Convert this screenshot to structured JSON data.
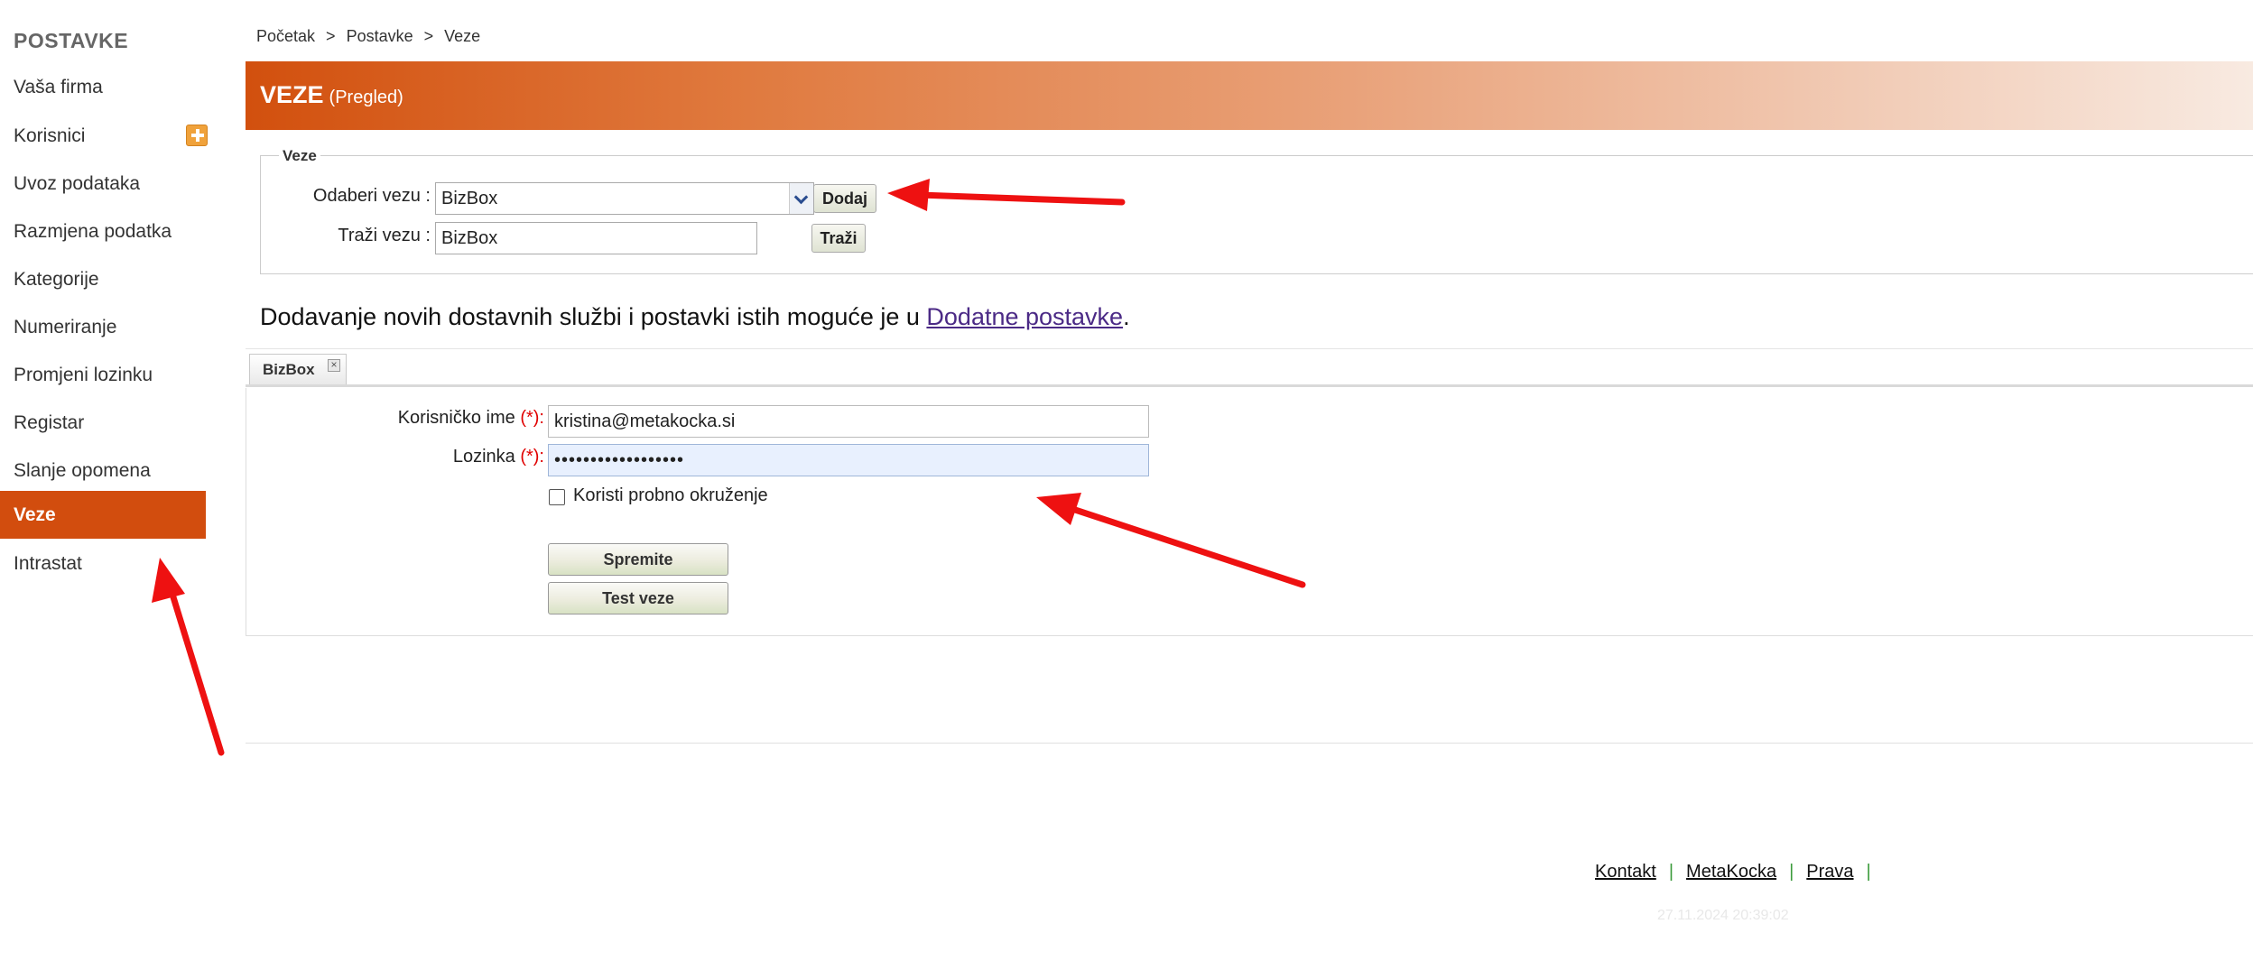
{
  "sidebar": {
    "title": "POSTAVKE",
    "items": [
      {
        "label": "Vaša firma"
      },
      {
        "label": "Korisnici"
      },
      {
        "label": "Uvoz podataka"
      },
      {
        "label": "Razmjena podatka"
      },
      {
        "label": "Kategorije"
      },
      {
        "label": "Numeriranje"
      },
      {
        "label": "Promjeni lozinku"
      },
      {
        "label": "Registar"
      },
      {
        "label": "Slanje opomena"
      },
      {
        "label": "Veze"
      },
      {
        "label": "Intrastat"
      }
    ],
    "active": "Veze",
    "korisnici_icon": "plus-icon"
  },
  "breadcrumb": {
    "items": [
      "Početak",
      "Postavke",
      "Veze"
    ],
    "separator": ">"
  },
  "header": {
    "title": "VEZE",
    "subtitle": "(Pregled)",
    "accent_color": "#d2500e"
  },
  "veze": {
    "legend": "Veze",
    "select_label": "Odaberi vezu :",
    "select_value": "BizBox",
    "add_button": "Dodaj",
    "search_label": "Traži vezu :",
    "search_value": "BizBox",
    "search_button": "Traži"
  },
  "info": {
    "text": "Dodavanje novih dostavnih službi i postavki istih moguće je u ",
    "link": "Dodatne postavke",
    "suffix": "."
  },
  "tabs": [
    {
      "label": "BizBox",
      "close_icon": "close-icon"
    }
  ],
  "form": {
    "username_label": "Korisničko ime",
    "username_value": "kristina@metakocka.si",
    "password_label": "Lozinka",
    "password_value": "••••••••••••••••••",
    "required_mark": "(*):",
    "checkbox_label": "Koristi probno okruženje",
    "checkbox_checked": false,
    "save_button": "Spremite",
    "test_button": "Test veze"
  },
  "footer": {
    "links": [
      "Kontakt",
      "MetaKocka",
      "Prava"
    ],
    "separator": "|",
    "timestamp": "27.11.2024 20:39:02"
  }
}
